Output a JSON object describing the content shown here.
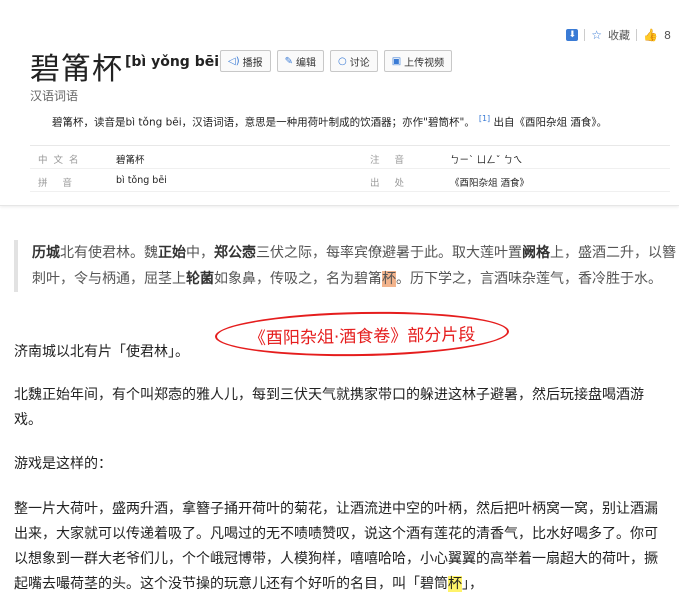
{
  "header": {
    "collect_label": "收藏",
    "like_count": "8",
    "title": "碧筩杯",
    "pinyin": "[bì yǒng bēi]",
    "buttons": [
      {
        "label": "播报",
        "icon": "speaker-icon"
      },
      {
        "label": "编辑",
        "icon": "pencil-icon"
      },
      {
        "label": "讨论",
        "icon": "chat-icon"
      },
      {
        "label": "上传视频",
        "icon": "video-icon"
      }
    ],
    "subtitle": "汉语词语",
    "summary": "碧筩杯，读音是bì tǒng bēi，汉语词语，意思是一种用荷叶制成的饮酒器；亦作\"碧筒杯\"。",
    "summary_ref": "[1]",
    "summary_tail": "出自《酉阳杂俎 酒食》。"
  },
  "infobox": {
    "label_cn": "中文名",
    "value_cn": "碧筩杯",
    "label_zhuyin": "注 音",
    "value_zhuyin": "ㄅㄧˋ ㄩㄥˇ ㄅㄟ",
    "label_pinyin": "拼 音",
    "value_pinyin": "bì tǒng bēi",
    "label_source": "出 处",
    "value_source": "《酉阳杂俎 酒食》"
  },
  "quote": {
    "t1": "历城",
    "t2": "北有使君林。魏",
    "t3": "正始",
    "t4": "中，",
    "t5": "郑公悫",
    "t6": "三伏之际，每率宾僚避暑于此。取大莲叶置",
    "t7": "阙格",
    "t8": "上，盛酒二升，以簪刺叶，令与柄通，屈茎上",
    "t9": "轮菌",
    "t10": "如象鼻，传吸之，名为碧筩",
    "t11": "杯",
    "t12": "。历下学之，言酒味杂莲气，香冷胜于水。"
  },
  "stamp_text": "《酉阳杂俎·酒食卷》部分片段",
  "paragraphs": {
    "p1": "济南城以北有片「使君林」。",
    "p2": "北魏正始年间，有个叫郑悫的雅人儿，每到三伏天气就携家带口的躲进这林子避暑，然后玩接盘喝酒游戏。",
    "p3": "游戏是这样的：",
    "p4a": "整一片大荷叶，盛两升酒，拿簪子捅开荷叶的菊花，让酒流进中空的叶柄，然后把叶柄窝一窝，别让酒漏出来，大家就可以传递着吸了。凡喝过的无不啧啧赞叹，说这个酒有莲花的清香气，比水好喝多了。你可以想象到一群大老爷们儿，个个峨冠博带，人模狗样，嘻嘻哈哈，小心翼翼的高举着一扇超大的荷叶，撅起嘴去嘬荷茎的头。这个没节操的玩意儿还有个好听的名目，叫「碧筒",
    "p4b": "杯",
    "p4c": "」，"
  }
}
